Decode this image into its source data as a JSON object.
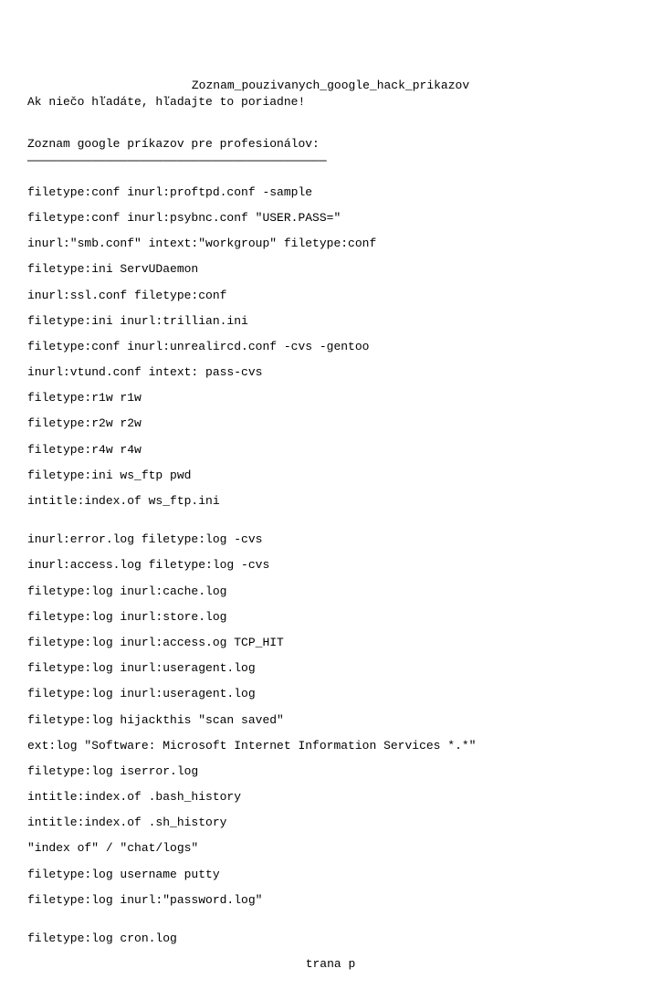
{
  "title": "Zoznam_pouzivanych_google_hack_prikazov",
  "subtitle": "Ak niečo hľadáte, hľadajte to poriadne!",
  "section_heading": "Zoznam google príkazov pre profesionálov:",
  "underline": "──────────────────────────────────────────",
  "commands_block1": [
    "filetype:conf inurl:proftpd.conf -sample",
    "filetype:conf inurl:psybnc.conf \"USER.PASS=\"",
    "inurl:\"smb.conf\" intext:\"workgroup\" filetype:conf",
    "filetype:ini ServUDaemon",
    "inurl:ssl.conf filetype:conf",
    "filetype:ini inurl:trillian.ini",
    "filetype:conf inurl:unrealircd.conf -cvs -gentoo",
    "inurl:vtund.conf intext: pass-cvs",
    "filetype:r1w r1w",
    "filetype:r2w r2w",
    "filetype:r4w r4w",
    "filetype:ini ws_ftp pwd",
    "intitle:index.of ws_ftp.ini"
  ],
  "commands_block2": [
    "inurl:error.log filetype:log -cvs",
    "inurl:access.log filetype:log -cvs",
    "filetype:log inurl:cache.log",
    "filetype:log inurl:store.log",
    "filetype:log inurl:access.og TCP_HIT",
    "filetype:log inurl:useragent.log",
    "filetype:log inurl:useragent.log",
    "filetype:log hijackthis \"scan saved\"",
    "ext:log \"Software: Microsoft Internet Information Services *.*\"",
    "filetype:log iserror.log",
    "intitle:index.of .bash_history",
    "intitle:index.of .sh_history",
    "\"index of\" / \"chat/logs\"",
    "filetype:log username putty",
    "filetype:log inurl:\"password.log\""
  ],
  "commands_block3": [
    "filetype:log cron.log"
  ],
  "footer": "trana p"
}
